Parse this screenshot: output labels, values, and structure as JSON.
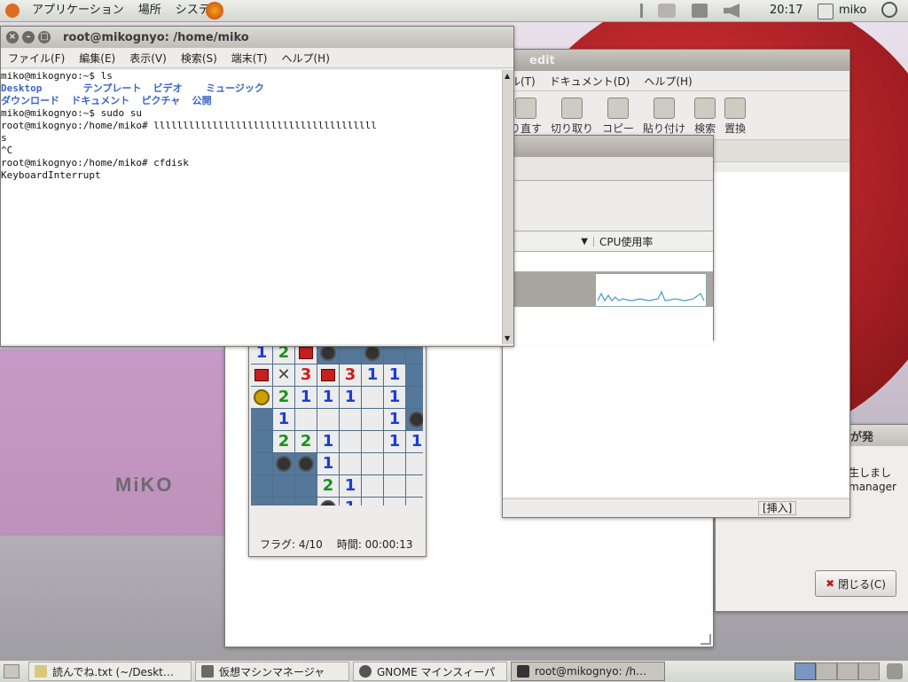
{
  "top_panel": {
    "menus": [
      "アプリケーション",
      "場所",
      "システム"
    ],
    "clock": "20:17",
    "user": "miko"
  },
  "wallpaper": {
    "logo_text": "MiKO"
  },
  "terminal": {
    "title": "root@mikognyo: /home/miko",
    "menus": [
      "ファイル(F)",
      "編集(E)",
      "表示(V)",
      "検索(S)",
      "端末(T)",
      "ヘルプ(H)"
    ],
    "lines": {
      "l1": "miko@mikognyo:~$ ls",
      "l2a": "Desktop       テンプレート  ビデオ    ミュージック",
      "l3a": "ダウンロード  ドキュメント  ピクチャ  公開",
      "l4": "miko@mikognyo:~$ sudo su",
      "l5": "root@mikognyo:/home/miko# llllllllllllllllllllllllllllllllllllll",
      "l6": "s",
      "l7": "^C",
      "l8": "root@mikognyo:/home/miko# cfdisk",
      "l9": "KeyboardInterrupt"
    }
  },
  "gedit": {
    "title_fragment": "edit",
    "menus": [
      "ル(T)",
      "ドキュメント(D)",
      "ヘルプ(H)"
    ],
    "tools": [
      "り直す",
      "切り取り",
      "コピー",
      "貼り付け",
      "検索",
      "置換"
    ],
    "status_insert": "[挿入]"
  },
  "sysmon": {
    "column_header": "CPU使用率"
  },
  "minesweeper": {
    "status_flags": "フラグ: 4/10",
    "status_time": "時間: 00:00:13"
  },
  "dialog": {
    "title_fragment": "が発",
    "text_line1": "生しまし",
    "text_line2": "manager",
    "close_button": "閉じる(C)"
  },
  "taskbar": {
    "tasks": [
      "読んでね.txt (~/Deskt…",
      "仮想マシンマネージャ",
      "GNOME マインスィーパ",
      "root@mikognyo: /h…"
    ]
  }
}
